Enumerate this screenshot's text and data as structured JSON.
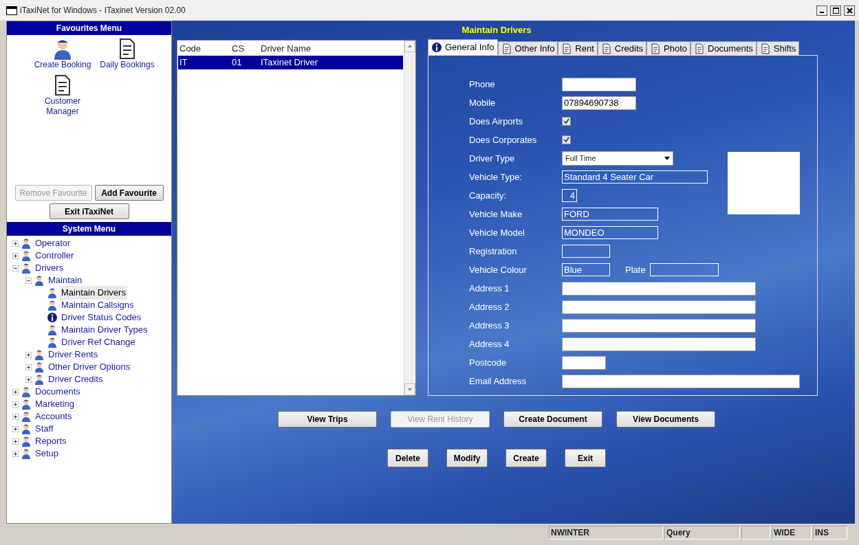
{
  "window": {
    "title": "iTaxiNet for Windows - ITaxinet Version 02.00"
  },
  "favourites": {
    "title": "Favourites Menu",
    "items": [
      {
        "label": "Create Booking"
      },
      {
        "label": "Daily Bookings"
      },
      {
        "label": "Customer Manager"
      }
    ],
    "buttons": [
      {
        "label": "Remove Favourite",
        "disabled": true
      },
      {
        "label": "Add Favourite",
        "disabled": false
      },
      {
        "label": "Exit iTaxiNet",
        "disabled": false
      }
    ]
  },
  "system_menu": {
    "title": "System Menu",
    "items": [
      {
        "label": "Operator",
        "expanded": false,
        "selected": false
      },
      {
        "label": "Controller",
        "expanded": false,
        "selected": false
      },
      {
        "label": "Drivers",
        "expanded": true,
        "selected": false,
        "children": [
          {
            "label": "Maintain",
            "expanded": true,
            "selected": false,
            "children": [
              {
                "label": "Maintain Drivers",
                "selected": true
              },
              {
                "label": "Maintain Callsigns",
                "selected": false
              },
              {
                "label": "Driver Status Codes",
                "selected": false
              },
              {
                "label": "Maintain Driver Types",
                "selected": false
              },
              {
                "label": "Driver Ref Change",
                "selected": false
              }
            ]
          },
          {
            "label": "Driver Rents",
            "expanded": false,
            "selected": false
          },
          {
            "label": "Other Driver Options",
            "expanded": false,
            "selected": false
          },
          {
            "label": "Driver Credits",
            "expanded": false,
            "selected": false
          }
        ]
      },
      {
        "label": "Documents",
        "expanded": false,
        "selected": false
      },
      {
        "label": "Marketing",
        "expanded": false,
        "selected": false
      },
      {
        "label": "Accounts",
        "expanded": false,
        "selected": false
      },
      {
        "label": "Staff",
        "expanded": false,
        "selected": false
      },
      {
        "label": "Reports",
        "expanded": false,
        "selected": false
      },
      {
        "label": "Setup",
        "expanded": false,
        "selected": false
      }
    ]
  },
  "page_title": "Maintain Drivers",
  "driver_list": {
    "columns": [
      "Code",
      "CS",
      "Driver Name"
    ],
    "rows": [
      {
        "cells": [
          "IT",
          "01",
          "ITaxinet Driver"
        ],
        "selected": true
      }
    ]
  },
  "tabs": [
    {
      "label": "General Info",
      "selected": true
    },
    {
      "label": "Other Info",
      "selected": false
    },
    {
      "label": "Rent",
      "selected": false
    },
    {
      "label": "Credits",
      "selected": false
    },
    {
      "label": "Photo",
      "selected": false
    },
    {
      "label": "Documents",
      "selected": false
    },
    {
      "label": "Shifts",
      "selected": false
    }
  ],
  "form": [
    {
      "label": "Phone",
      "kind": "input"
    },
    {
      "label": "Mobile",
      "kind": "input",
      "value": "07894690738"
    },
    {
      "label": "Does Airports",
      "kind": "check",
      "checked": true
    },
    {
      "label": "Does Corporates",
      "kind": "check",
      "checked": true
    },
    {
      "label": "Driver Type",
      "kind": "select",
      "value": "Full Time"
    },
    {
      "label": "Vehicle Type:",
      "kind": "outline",
      "value": "Standard 4 Seater Car"
    },
    {
      "label": "Capacity:",
      "kind": "outline",
      "value": "4"
    },
    {
      "label": "Vehicle Make",
      "kind": "outline",
      "value": "FORD"
    },
    {
      "label": "Vehicle Model",
      "kind": "outline",
      "value": "MONDEO"
    },
    {
      "label": "Registration",
      "kind": "outline"
    },
    {
      "label": "Vehicle Colour",
      "kind": "pair",
      "value": "Blue",
      "second_label": "Plate"
    },
    {
      "label": "Address 1",
      "kind": "input"
    },
    {
      "label": "Address 2",
      "kind": "input"
    },
    {
      "label": "Address 3",
      "kind": "input"
    },
    {
      "label": "Address 4",
      "kind": "input"
    },
    {
      "label": "Postcode",
      "kind": "input"
    },
    {
      "label": "Email Address",
      "kind": "input"
    }
  ],
  "action_buttons": [
    {
      "label": "View Trips",
      "disabled": false
    },
    {
      "label": "View Rent History",
      "disabled": true
    },
    {
      "label": "Create Document",
      "disabled": false
    },
    {
      "label": "View Documents",
      "disabled": false
    }
  ],
  "bottom_buttons": [
    {
      "label": "Delete"
    },
    {
      "label": "Modify"
    },
    {
      "label": "Create"
    },
    {
      "label": "Exit"
    }
  ],
  "status_bar": [
    "NWINTER",
    "Query",
    "WIDE",
    "INS"
  ]
}
